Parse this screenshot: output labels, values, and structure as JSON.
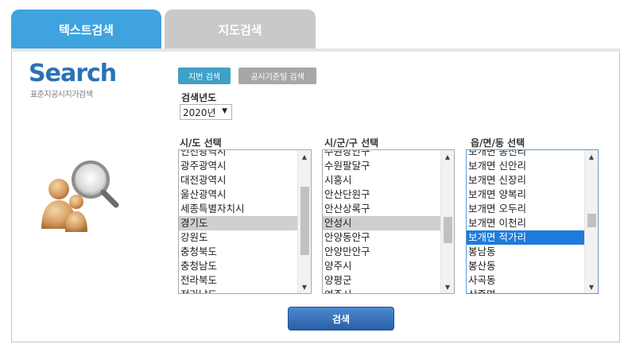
{
  "tabs": {
    "text_search": "텍스트검색",
    "map_search": "지도검색"
  },
  "logo": {
    "word": "Search",
    "subtitle": "표준지공시지가검색"
  },
  "search_type": {
    "lot_number": "지번 검색",
    "notice_date": "공시기준일 검색"
  },
  "year": {
    "label": "검색년도",
    "value": "2020년"
  },
  "sido": {
    "label": "시/도 선택",
    "items": [
      "인천광역시",
      "광주광역시",
      "대전광역시",
      "울산광역시",
      "세종특별자치시",
      "경기도",
      "강원도",
      "충청북도",
      "충청남도",
      "전라북도",
      "전라남도"
    ],
    "selected": "경기도"
  },
  "sigungu": {
    "label": "시/군/구 선택",
    "items": [
      "수원장안구",
      "수원팔달구",
      "시흥시",
      "안산단원구",
      "안산상록구",
      "안성시",
      "안양동안구",
      "안양만안구",
      "양주시",
      "양평군",
      "여주시"
    ],
    "selected": "안성시"
  },
  "eupmyeondong": {
    "label": "읍/면/동 선택",
    "items": [
      "보개면 동신리",
      "보개면 신안리",
      "보개면 신장리",
      "보개면 양복리",
      "보개면 오두리",
      "보개면 이천리",
      "보개면 적가리",
      "봉남동",
      "봉산동",
      "사곡동",
      "삼죽면"
    ],
    "selected": "보개면 적가리"
  },
  "submit_label": "검색",
  "colors": {
    "active_tab": "#3fa3e0",
    "inactive_tab": "#c9c9cc",
    "logo": "#2a72b5",
    "lot_button": "#3fa0c8",
    "date_button": "#a7a7a9",
    "selection_blue": "#1e7bdb",
    "selection_grey": "#cfcfcf"
  }
}
